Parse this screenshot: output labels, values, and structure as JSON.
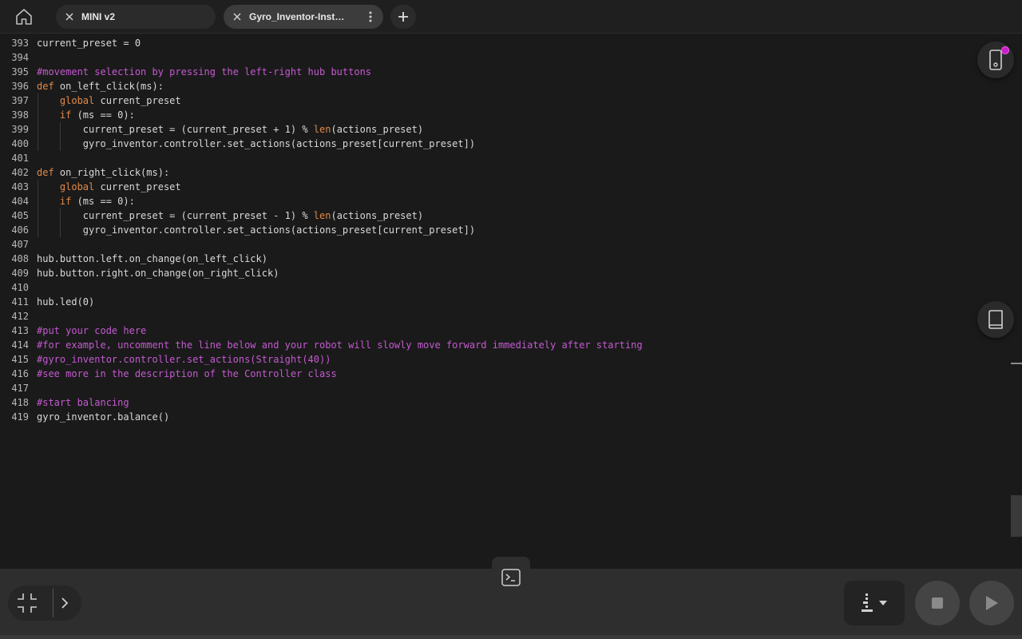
{
  "tabs": [
    {
      "label": "MINI v2"
    },
    {
      "label": "Gyro_Inventor-Instr…"
    }
  ],
  "editor": {
    "lines": [
      {
        "n": "393",
        "html": "current_preset = 0"
      },
      {
        "n": "394",
        "html": ""
      },
      {
        "n": "395",
        "html": "<span class=\"cm\">#movement selection by pressing the left-right hub buttons</span>"
      },
      {
        "n": "396",
        "html": "<span class=\"kw\">def</span> on_left_click(ms):"
      },
      {
        "n": "397",
        "html": "    <span class=\"kw\">global</span> current_preset"
      },
      {
        "n": "398",
        "html": "    <span class=\"kw\">if</span> (ms == 0):"
      },
      {
        "n": "399",
        "html": "        current_preset = (current_preset + 1) % <span class=\"kw\">len</span>(actions_preset)"
      },
      {
        "n": "400",
        "html": "        gyro_inventor.controller.set_actions(actions_preset[current_preset])"
      },
      {
        "n": "401",
        "html": ""
      },
      {
        "n": "402",
        "html": "<span class=\"kw\">def</span> on_right_click(ms):"
      },
      {
        "n": "403",
        "html": "    <span class=\"kw\">global</span> current_preset"
      },
      {
        "n": "404",
        "html": "    <span class=\"kw\">if</span> (ms == 0):"
      },
      {
        "n": "405",
        "html": "        current_preset = (current_preset - 1) % <span class=\"kw\">len</span>(actions_preset)"
      },
      {
        "n": "406",
        "html": "        gyro_inventor.controller.set_actions(actions_preset[current_preset])"
      },
      {
        "n": "407",
        "html": ""
      },
      {
        "n": "408",
        "html": "hub.button.left.on_change(on_left_click)"
      },
      {
        "n": "409",
        "html": "hub.button.right.on_change(on_right_click)"
      },
      {
        "n": "410",
        "html": ""
      },
      {
        "n": "411",
        "html": "hub.led(0)"
      },
      {
        "n": "412",
        "html": ""
      },
      {
        "n": "413",
        "html": "<span class=\"cm\">#put your code here</span>"
      },
      {
        "n": "414",
        "html": "<span class=\"cm\">#for example, uncomment the line below and your robot will slowly move forward immediately after starting</span>"
      },
      {
        "n": "415",
        "html": "<span class=\"cm\">#gyro_inventor.controller.set_actions(Straight(40))</span>"
      },
      {
        "n": "416",
        "html": "<span class=\"cm\">#see more in the description of the Controller class</span>"
      },
      {
        "n": "417",
        "html": ""
      },
      {
        "n": "418",
        "html": "<span class=\"cm\">#start balancing</span>"
      },
      {
        "n": "419",
        "html": "gyro_inventor.balance()"
      }
    ]
  },
  "colors": {
    "keyword": "#e08a4a",
    "comment": "#c45ad0",
    "notification_dot": "#c81ec8"
  },
  "icons": {
    "home": "home-icon",
    "close": "close-icon",
    "more": "kebab-icon",
    "add": "plus-icon",
    "device": "hub-device-icon",
    "docs": "book-icon",
    "console": "terminal-icon",
    "collapse": "collapse-icon",
    "expand": "chevron-right-icon",
    "hub_select": "hub-port-icon",
    "stop": "stop-icon",
    "run": "play-icon"
  }
}
